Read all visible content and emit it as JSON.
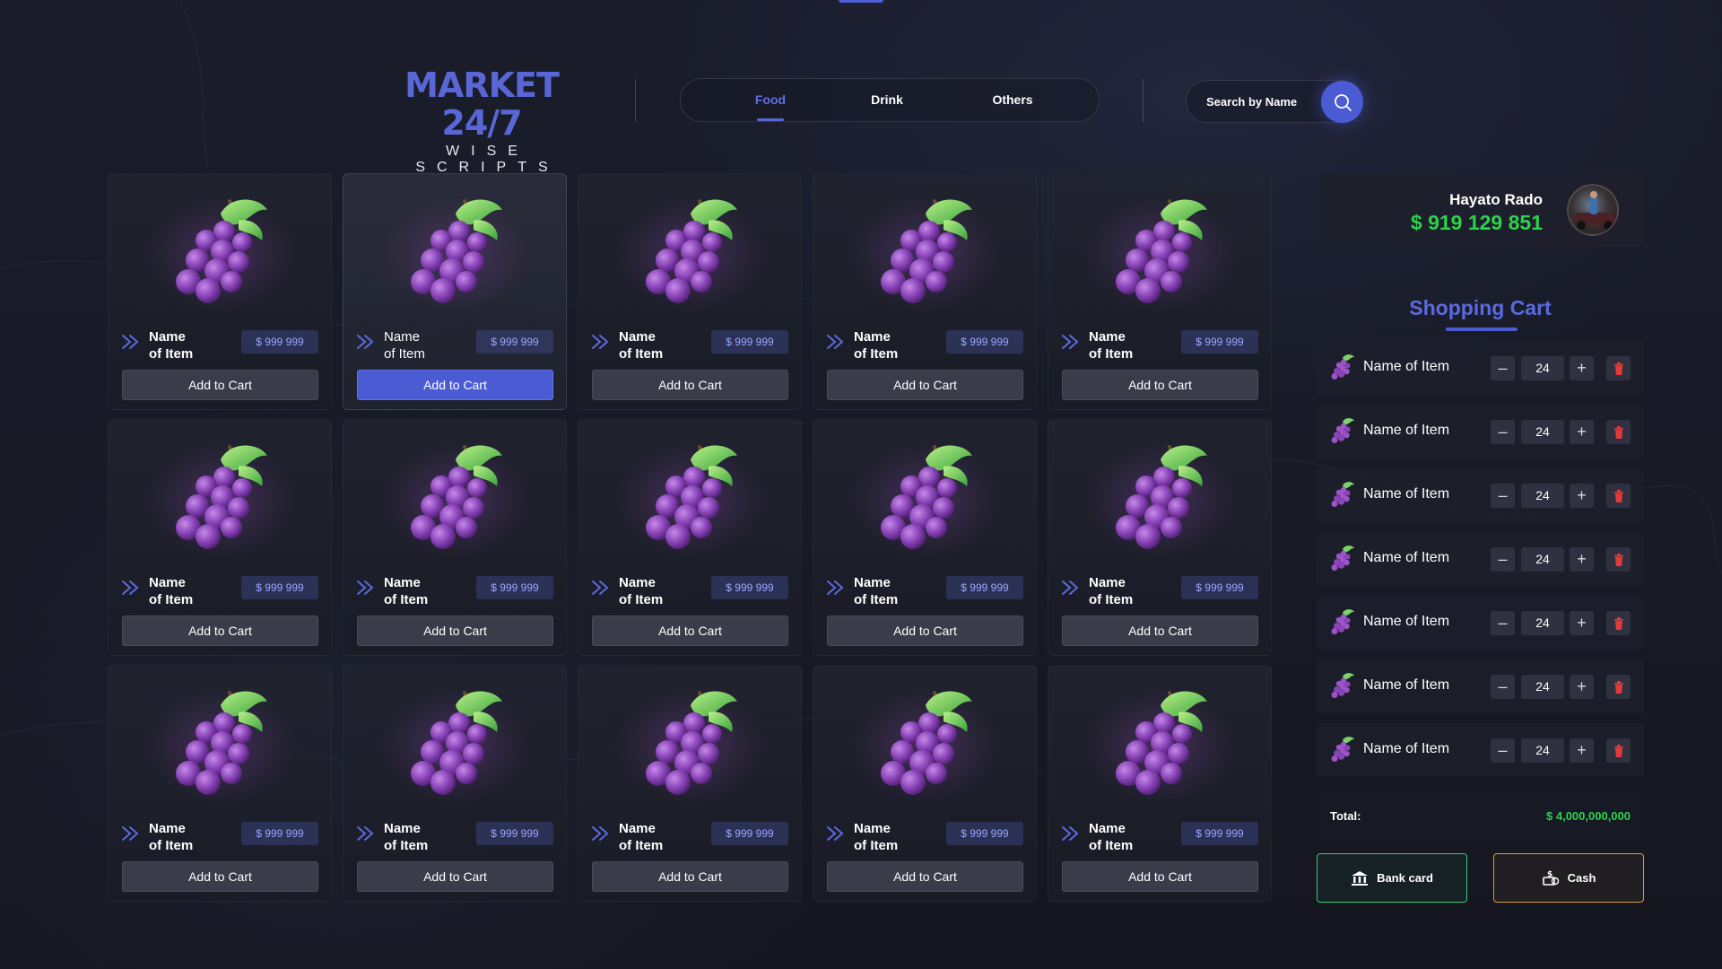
{
  "brand": {
    "title": "MARKET 24/7",
    "subtitle": "WISE SCRIPTS"
  },
  "tabs": [
    {
      "label": "Food",
      "active": true
    },
    {
      "label": "Drink",
      "active": false
    },
    {
      "label": "Others",
      "active": false
    }
  ],
  "search": {
    "placeholder": "Search by Name",
    "icon": "search-icon"
  },
  "products": {
    "item_icon": "grapes-icon",
    "add_label": "Add to Cart",
    "items": [
      {
        "name_line1": "Name",
        "name_line2": "of Item",
        "price": "$ 999 999",
        "highlighted": false
      },
      {
        "name_line1": "Name",
        "name_line2": "of Item",
        "price": "$ 999 999",
        "highlighted": true
      },
      {
        "name_line1": "Name",
        "name_line2": "of Item",
        "price": "$ 999 999",
        "highlighted": false
      },
      {
        "name_line1": "Name",
        "name_line2": "of Item",
        "price": "$ 999 999",
        "highlighted": false
      },
      {
        "name_line1": "Name",
        "name_line2": "of Item",
        "price": "$ 999 999",
        "highlighted": false
      },
      {
        "name_line1": "Name",
        "name_line2": "of Item",
        "price": "$ 999 999",
        "highlighted": false
      },
      {
        "name_line1": "Name",
        "name_line2": "of Item",
        "price": "$ 999 999",
        "highlighted": false
      },
      {
        "name_line1": "Name",
        "name_line2": "of Item",
        "price": "$ 999 999",
        "highlighted": false
      },
      {
        "name_line1": "Name",
        "name_line2": "of Item",
        "price": "$ 999 999",
        "highlighted": false
      },
      {
        "name_line1": "Name",
        "name_line2": "of Item",
        "price": "$ 999 999",
        "highlighted": false
      },
      {
        "name_line1": "Name",
        "name_line2": "of Item",
        "price": "$ 999 999",
        "highlighted": false
      },
      {
        "name_line1": "Name",
        "name_line2": "of Item",
        "price": "$ 999 999",
        "highlighted": false
      },
      {
        "name_line1": "Name",
        "name_line2": "of Item",
        "price": "$ 999 999",
        "highlighted": false
      },
      {
        "name_line1": "Name",
        "name_line2": "of Item",
        "price": "$ 999 999",
        "highlighted": false
      },
      {
        "name_line1": "Name",
        "name_line2": "of Item",
        "price": "$ 999 999",
        "highlighted": false
      }
    ]
  },
  "user": {
    "name": "Hayato Rado",
    "money": "$ 919 129 851"
  },
  "cart": {
    "title": "Shopping Cart",
    "items": [
      {
        "name": "Name of Item",
        "qty": "24"
      },
      {
        "name": "Name of Item",
        "qty": "24"
      },
      {
        "name": "Name of Item",
        "qty": "24"
      },
      {
        "name": "Name of Item",
        "qty": "24"
      },
      {
        "name": "Name of Item",
        "qty": "24"
      },
      {
        "name": "Name of Item",
        "qty": "24"
      },
      {
        "name": "Name of Item",
        "qty": "24"
      }
    ],
    "total_label": "Total:",
    "total_value": "$ 4,000,000,000"
  },
  "payment": {
    "bank_label": "Bank card",
    "cash_label": "Cash"
  },
  "colors": {
    "accent": "#4b5bd3",
    "money_green": "#2bd34a",
    "bank_border": "#2ed07a",
    "cash_border": "#d9a132",
    "delete_red": "#e03a3a"
  }
}
